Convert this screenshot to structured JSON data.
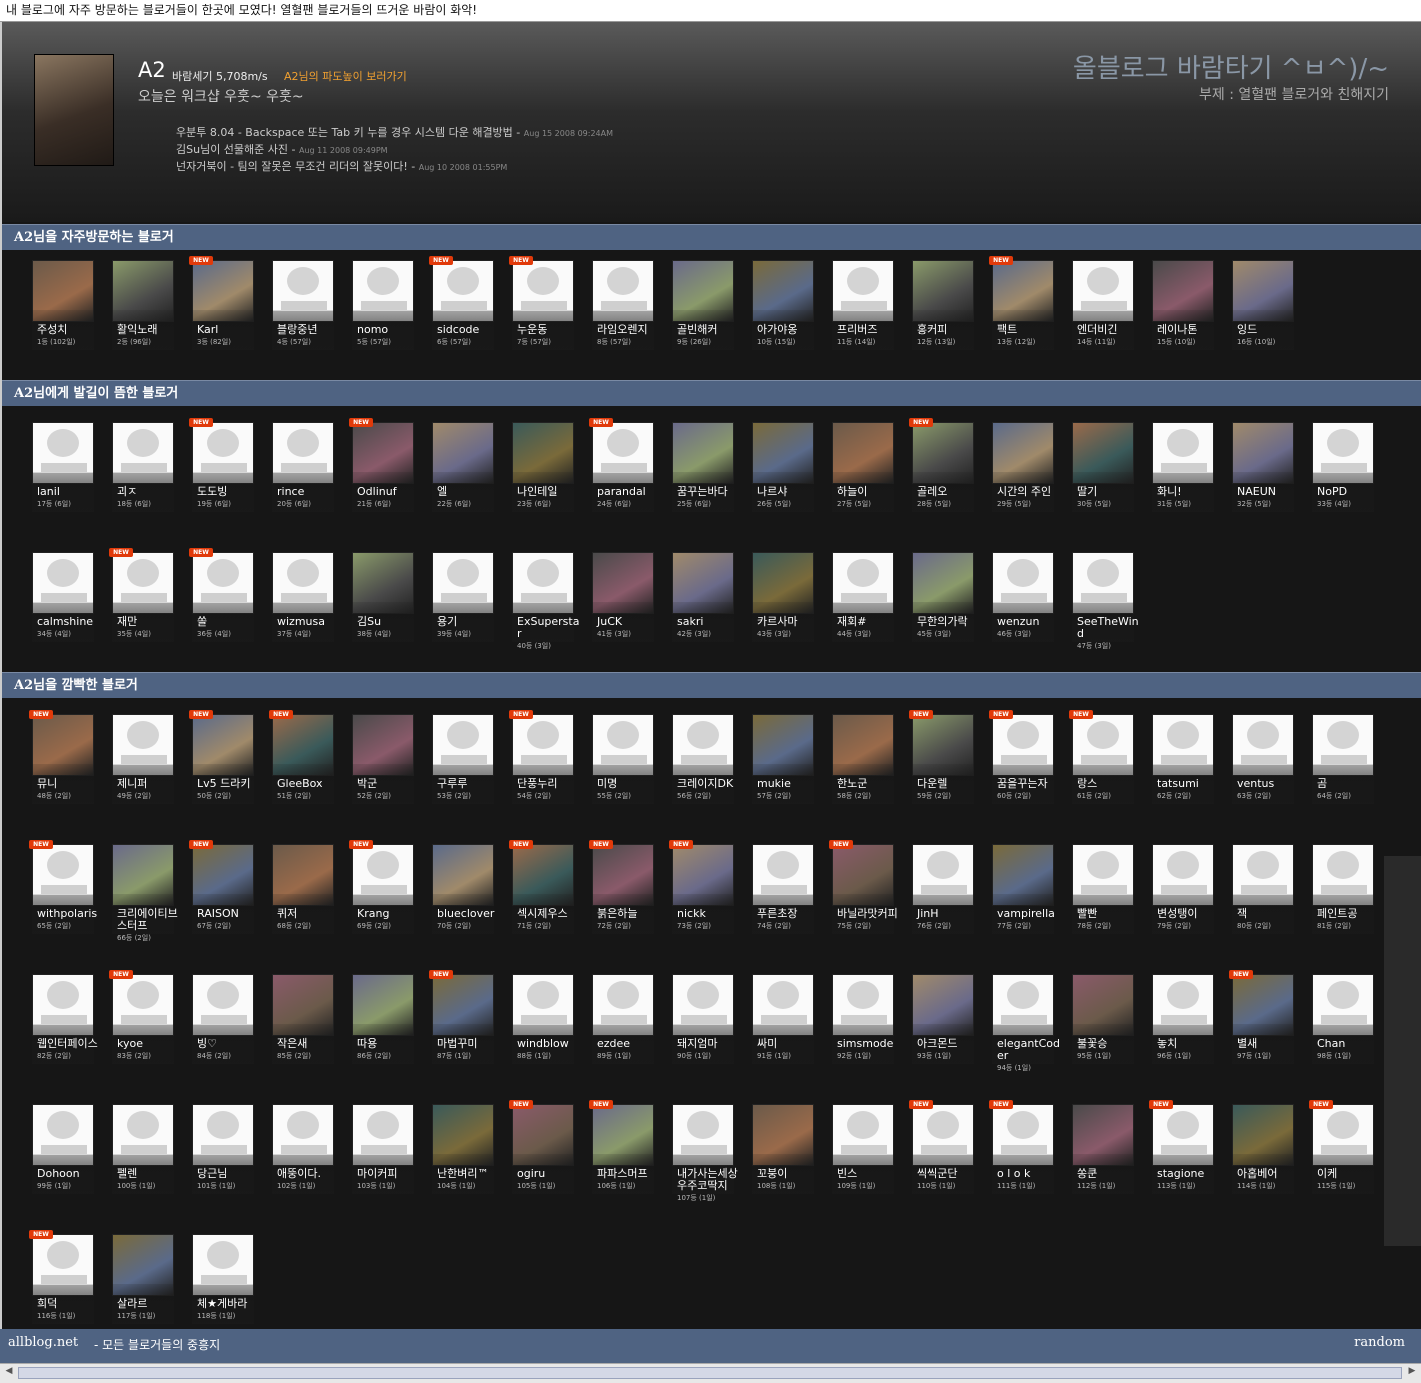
{
  "topbar": {
    "text": "내 블로그에 자주 방문하는 블로거들이 한곳에 모였다! 열혈팬 블로거들의 뜨거운 바람이 화악!"
  },
  "profile": {
    "name": "A2",
    "wind": "바람세기 5,708m/s",
    "wave_link": "A2님의 파도높이 보러가기",
    "status": "오늘은 워크샵 우훗~ 우훗~"
  },
  "posts": [
    {
      "title": "우분투 8.04 - Backspace 또는 Tab 키 누를 경우 시스템 다운 해결방법",
      "date": "Aug 15 2008 09:24AM"
    },
    {
      "title": "김Su님이 선물해준 사진",
      "date": "Aug 11 2008 09:49PM"
    },
    {
      "title": "넌자거북이 - 팀의 잘못은 무조건 리더의 잘못이다!",
      "date": "Aug 10 2008 01:55PM"
    }
  ],
  "blog": {
    "title": "올블로그 바람타기 ^ㅂ^)/~",
    "subtitle": "부제 : 열혈팬 블로거와 친해지기"
  },
  "sections": {
    "frequent": "A2님을 자주방문하는 블로거",
    "touched": "A2님에게 발길이 뜸한 블로거",
    "blinked": "A2님을 깜빡한 블로거"
  },
  "frequent": [
    {
      "name": "주성치",
      "rank": "1등 (102일)",
      "img": "photo",
      "new": false
    },
    {
      "name": "활익노래",
      "rank": "2등 (96일)",
      "img": "photo",
      "new": false
    },
    {
      "name": "Karl",
      "rank": "3등 (82일)",
      "img": "photo",
      "new": true
    },
    {
      "name": "블랑중년",
      "rank": "4등 (57일)",
      "img": "none",
      "new": false
    },
    {
      "name": "nomo",
      "rank": "5등 (57일)",
      "img": "none",
      "new": false
    },
    {
      "name": "sidcode",
      "rank": "6등 (57일)",
      "img": "none",
      "new": true
    },
    {
      "name": "누운동",
      "rank": "7등 (57일)",
      "img": "none",
      "new": true
    },
    {
      "name": "라임오렌지",
      "rank": "8등 (57일)",
      "img": "none",
      "new": false
    },
    {
      "name": "골빈해커",
      "rank": "9등 (26일)",
      "img": "photo",
      "new": false
    },
    {
      "name": "아가야옹",
      "rank": "10등 (15일)",
      "img": "photo",
      "new": false
    },
    {
      "name": "프리버즈",
      "rank": "11등 (14일)",
      "img": "none",
      "new": false
    },
    {
      "name": "홍커피",
      "rank": "12등 (13일)",
      "img": "photo",
      "new": false
    },
    {
      "name": "팩트",
      "rank": "13등 (12일)",
      "img": "photo",
      "new": true
    },
    {
      "name": "엔더비긴",
      "rank": "14등 (11일)",
      "img": "none",
      "new": false
    },
    {
      "name": "레이나톤",
      "rank": "15등 (10일)",
      "img": "photo",
      "new": false
    },
    {
      "name": "잉드",
      "rank": "16등 (10일)",
      "img": "photo",
      "new": false
    }
  ],
  "touched": [
    {
      "name": "lanil",
      "rank": "17등 (6일)",
      "img": "none",
      "new": false
    },
    {
      "name": "괴ㅈ",
      "rank": "18등 (6일)",
      "img": "none",
      "new": false
    },
    {
      "name": "도도빙",
      "rank": "19등 (6일)",
      "img": "none",
      "new": true
    },
    {
      "name": "rince",
      "rank": "20등 (6일)",
      "img": "none",
      "new": false
    },
    {
      "name": "Odlinuf",
      "rank": "21등 (6일)",
      "img": "photo",
      "new": true
    },
    {
      "name": "엘",
      "rank": "22등 (6일)",
      "img": "photo",
      "new": false
    },
    {
      "name": "나인테일",
      "rank": "23등 (6일)",
      "img": "photo",
      "new": false
    },
    {
      "name": "parandal",
      "rank": "24등 (6일)",
      "img": "none",
      "new": true
    },
    {
      "name": "꿈꾸는바다",
      "rank": "25등 (6일)",
      "img": "photo",
      "new": false
    },
    {
      "name": "나르샤",
      "rank": "26등 (5일)",
      "img": "photo",
      "new": false
    },
    {
      "name": "하늘이",
      "rank": "27등 (5일)",
      "img": "photo",
      "new": false
    },
    {
      "name": "골레오",
      "rank": "28등 (5일)",
      "img": "photo",
      "new": true
    },
    {
      "name": "시간의 주인",
      "rank": "29등 (5일)",
      "img": "photo",
      "new": false
    },
    {
      "name": "딸기",
      "rank": "30등 (5일)",
      "img": "photo",
      "new": false
    },
    {
      "name": "화니!",
      "rank": "31등 (5일)",
      "img": "none",
      "new": false
    },
    {
      "name": "NAEUN",
      "rank": "32등 (5일)",
      "img": "photo",
      "new": false
    },
    {
      "name": "NoPD",
      "rank": "33등 (4일)",
      "img": "none",
      "new": false
    },
    {
      "name": "calmshine",
      "rank": "34등 (4일)",
      "img": "none",
      "new": false
    },
    {
      "name": "재만",
      "rank": "35등 (4일)",
      "img": "none",
      "new": true
    },
    {
      "name": "쏠",
      "rank": "36등 (4일)",
      "img": "none",
      "new": true
    },
    {
      "name": "wizmusa",
      "rank": "37등 (4일)",
      "img": "none",
      "new": false
    },
    {
      "name": "김Su",
      "rank": "38등 (4일)",
      "img": "photo",
      "new": false
    },
    {
      "name": "용기",
      "rank": "39등 (4일)",
      "img": "none",
      "new": false
    },
    {
      "name": "ExSuperstar",
      "rank": "40등 (3일)",
      "img": "none",
      "new": false
    },
    {
      "name": "JuCK",
      "rank": "41등 (3일)",
      "img": "photo",
      "new": false
    },
    {
      "name": "sakri",
      "rank": "42등 (3일)",
      "img": "photo",
      "new": false
    },
    {
      "name": "카르사마",
      "rank": "43등 (3일)",
      "img": "photo",
      "new": false
    },
    {
      "name": "재회#",
      "rank": "44등 (3일)",
      "img": "none",
      "new": false
    },
    {
      "name": "무한의가락",
      "rank": "45등 (3일)",
      "img": "photo",
      "new": false
    },
    {
      "name": "wenzun",
      "rank": "46등 (3일)",
      "img": "none",
      "new": false
    },
    {
      "name": "SeeTheWind",
      "rank": "47등 (3일)",
      "img": "none",
      "new": false
    }
  ],
  "blinked": [
    {
      "name": "뮤니",
      "rank": "48등 (2일)",
      "img": "photo",
      "new": true
    },
    {
      "name": "제니퍼",
      "rank": "49등 (2일)",
      "img": "none",
      "new": false
    },
    {
      "name": "Lv5 드라키",
      "rank": "50등 (2일)",
      "img": "photo",
      "new": true
    },
    {
      "name": "GleeBox",
      "rank": "51등 (2일)",
      "img": "photo",
      "new": true
    },
    {
      "name": "박군",
      "rank": "52등 (2일)",
      "img": "photo",
      "new": false
    },
    {
      "name": "구루루",
      "rank": "53등 (2일)",
      "img": "none",
      "new": false
    },
    {
      "name": "단풍누리",
      "rank": "54등 (2일)",
      "img": "none",
      "new": true
    },
    {
      "name": "미명",
      "rank": "55등 (2일)",
      "img": "none",
      "new": false
    },
    {
      "name": "크레이지DK",
      "rank": "56등 (2일)",
      "img": "none",
      "new": false
    },
    {
      "name": "mukie",
      "rank": "57등 (2일)",
      "img": "photo",
      "new": false
    },
    {
      "name": "한노군",
      "rank": "58등 (2일)",
      "img": "photo",
      "new": false
    },
    {
      "name": "다운렐",
      "rank": "59등 (2일)",
      "img": "photo",
      "new": true
    },
    {
      "name": "꿈을꾸는자",
      "rank": "60등 (2일)",
      "img": "none",
      "new": true
    },
    {
      "name": "랑스",
      "rank": "61등 (2일)",
      "img": "none",
      "new": true
    },
    {
      "name": "tatsumi",
      "rank": "62등 (2일)",
      "img": "none",
      "new": false
    },
    {
      "name": "ventus",
      "rank": "63등 (2일)",
      "img": "none",
      "new": false
    },
    {
      "name": "곰",
      "rank": "64등 (2일)",
      "img": "none",
      "new": false
    },
    {
      "name": "withpolaris",
      "rank": "65등 (2일)",
      "img": "none",
      "new": true
    },
    {
      "name": "크리에이티브스터프",
      "rank": "66등 (2일)",
      "img": "photo",
      "new": false
    },
    {
      "name": "RAISON",
      "rank": "67등 (2일)",
      "img": "photo",
      "new": true
    },
    {
      "name": "퀴저",
      "rank": "68등 (2일)",
      "img": "photo",
      "new": false
    },
    {
      "name": "Krang",
      "rank": "69등 (2일)",
      "img": "none",
      "new": true
    },
    {
      "name": "blueclover",
      "rank": "70등 (2일)",
      "img": "photo",
      "new": false
    },
    {
      "name": "섹시제우스",
      "rank": "71등 (2일)",
      "img": "photo",
      "new": true
    },
    {
      "name": "붉은하늘",
      "rank": "72등 (2일)",
      "img": "photo",
      "new": true
    },
    {
      "name": "nickk",
      "rank": "73등 (2일)",
      "img": "photo",
      "new": true
    },
    {
      "name": "푸른초장",
      "rank": "74등 (2일)",
      "img": "none",
      "new": false
    },
    {
      "name": "바닐라맛커피",
      "rank": "75등 (2일)",
      "img": "photo",
      "new": true
    },
    {
      "name": "JinH",
      "rank": "76등 (2일)",
      "img": "none",
      "new": false
    },
    {
      "name": "vampirella",
      "rank": "77등 (2일)",
      "img": "photo",
      "new": false
    },
    {
      "name": "빨빤",
      "rank": "78등 (2일)",
      "img": "none",
      "new": false
    },
    {
      "name": "변성탱이",
      "rank": "79등 (2일)",
      "img": "none",
      "new": false
    },
    {
      "name": "잭",
      "rank": "80등 (2일)",
      "img": "none",
      "new": false
    },
    {
      "name": "페인트공",
      "rank": "81등 (2일)",
      "img": "none",
      "new": false
    },
    {
      "name": "웹인터페이스",
      "rank": "82등 (2일)",
      "img": "none",
      "new": false
    },
    {
      "name": "kyoe",
      "rank": "83등 (2일)",
      "img": "none",
      "new": true
    },
    {
      "name": "빙♡",
      "rank": "84등 (2일)",
      "img": "none",
      "new": false
    },
    {
      "name": "작은새",
      "rank": "85등 (2일)",
      "img": "photo",
      "new": false
    },
    {
      "name": "따용",
      "rank": "86등 (2일)",
      "img": "photo",
      "new": false
    },
    {
      "name": "마법꾸미",
      "rank": "87등 (1일)",
      "img": "photo",
      "new": true
    },
    {
      "name": "windblow",
      "rank": "88등 (1일)",
      "img": "none",
      "new": false
    },
    {
      "name": "ezdee",
      "rank": "89등 (1일)",
      "img": "none",
      "new": false
    },
    {
      "name": "돼지엄마",
      "rank": "90등 (1일)",
      "img": "none",
      "new": false
    },
    {
      "name": "싸미",
      "rank": "91등 (1일)",
      "img": "none",
      "new": false
    },
    {
      "name": "simsmode",
      "rank": "92등 (1일)",
      "img": "none",
      "new": false
    },
    {
      "name": "아크몬드",
      "rank": "93등 (1일)",
      "img": "photo",
      "new": false
    },
    {
      "name": "elegantCoder",
      "rank": "94등 (1일)",
      "img": "none",
      "new": false
    },
    {
      "name": "불꽃승",
      "rank": "95등 (1일)",
      "img": "photo",
      "new": false
    },
    {
      "name": "놓치",
      "rank": "96등 (1일)",
      "img": "none",
      "new": false
    },
    {
      "name": "별새",
      "rank": "97등 (1일)",
      "img": "photo",
      "new": true
    },
    {
      "name": "Chan",
      "rank": "98등 (1일)",
      "img": "none",
      "new": false
    },
    {
      "name": "Dohoon",
      "rank": "99등 (1일)",
      "img": "none",
      "new": false
    },
    {
      "name": "펠렌",
      "rank": "100등 (1일)",
      "img": "none",
      "new": false
    },
    {
      "name": "당근님",
      "rank": "101등 (1일)",
      "img": "none",
      "new": false
    },
    {
      "name": "애뚱이다.",
      "rank": "102등 (1일)",
      "img": "none",
      "new": false
    },
    {
      "name": "마이커피",
      "rank": "103등 (1일)",
      "img": "none",
      "new": false
    },
    {
      "name": "난한벼리™",
      "rank": "104등 (1일)",
      "img": "photo",
      "new": false
    },
    {
      "name": "ogiru",
      "rank": "105등 (1일)",
      "img": "photo",
      "new": true
    },
    {
      "name": "파파스머프",
      "rank": "106등 (1일)",
      "img": "photo",
      "new": true
    },
    {
      "name": "내가사는세상우주코딱지",
      "rank": "107등 (1일)",
      "img": "none",
      "new": false
    },
    {
      "name": "꼬붕이",
      "rank": "108등 (1일)",
      "img": "photo",
      "new": false
    },
    {
      "name": "빈스",
      "rank": "109등 (1일)",
      "img": "none",
      "new": false
    },
    {
      "name": "씩씩군단",
      "rank": "110등 (1일)",
      "img": "none",
      "new": true
    },
    {
      "name": "o l o k",
      "rank": "111등 (1일)",
      "img": "none",
      "new": true
    },
    {
      "name": "쏭쿤",
      "rank": "112등 (1일)",
      "img": "photo",
      "new": false
    },
    {
      "name": "stagione",
      "rank": "113등 (1일)",
      "img": "none",
      "new": true
    },
    {
      "name": "아홉베어",
      "rank": "114등 (1일)",
      "img": "photo",
      "new": false
    },
    {
      "name": "이케",
      "rank": "115등 (1일)",
      "img": "none",
      "new": true
    },
    {
      "name": "희덕",
      "rank": "116등 (1일)",
      "img": "none",
      "new": true
    },
    {
      "name": "살라르",
      "rank": "117등 (1일)",
      "img": "photo",
      "new": false
    },
    {
      "name": "체★게바라",
      "rank": "118등 (1일)",
      "img": "none",
      "new": false
    }
  ],
  "footer": {
    "brand": "allblog.net",
    "desc": "- 모든 블로거들의 중흥지",
    "random": "random"
  },
  "colors": {
    "section_bar": "#4f6382",
    "new_badge": "#e13a0a",
    "wave_link": "#f0a030"
  }
}
